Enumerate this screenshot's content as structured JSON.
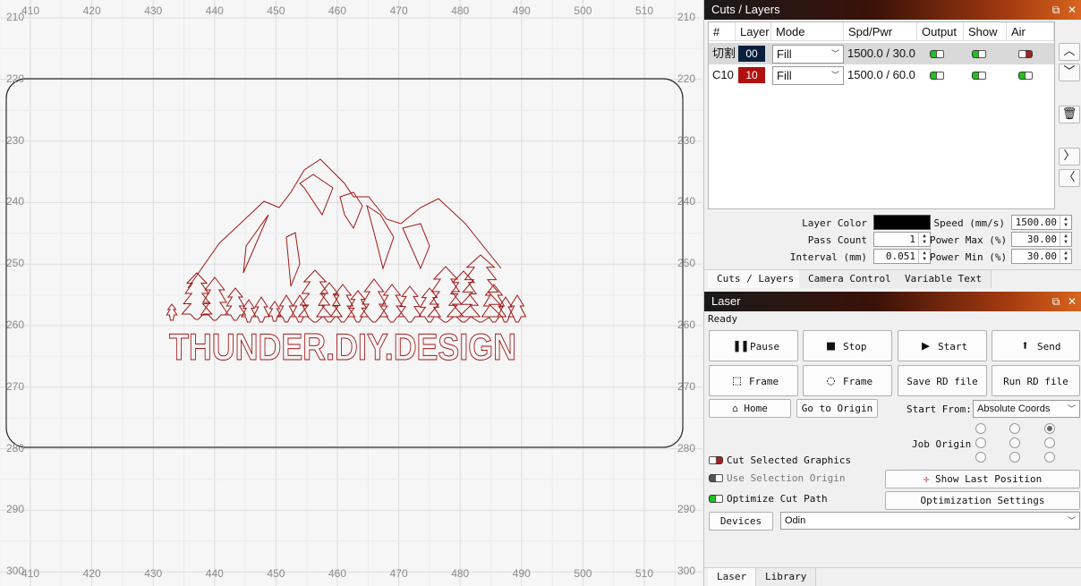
{
  "canvas": {
    "x_ticks": [
      "410",
      "420",
      "430",
      "440",
      "450",
      "460",
      "470",
      "480",
      "490",
      "500",
      "510"
    ],
    "y_ticks": [
      "210",
      "220",
      "230",
      "240",
      "250",
      "260",
      "270",
      "280",
      "290",
      "300"
    ],
    "design_text": "THUNDER.DIY.DESIGN",
    "design_color": "#a01818"
  },
  "cuts_panel": {
    "title": "Cuts / Layers",
    "columns": [
      "#",
      "Layer",
      "Mode",
      "Spd/Pwr",
      "Output",
      "Show",
      "Air"
    ],
    "rows": [
      {
        "num": "切割",
        "layer": "00",
        "layer_color": "#0a1f3d",
        "mode": "Fill",
        "spdpwr": "1500.0 / 30.0",
        "output": true,
        "show": true,
        "air": false
      },
      {
        "num": "C10",
        "layer": "10",
        "layer_color": "#b01010",
        "mode": "Fill",
        "spdpwr": "1500.0 / 60.0",
        "output": true,
        "show": true,
        "air": true
      }
    ],
    "props": {
      "layer_color_label": "Layer Color",
      "layer_color_value": "#000000",
      "pass_count_label": "Pass Count",
      "pass_count_value": "1",
      "interval_label": "Interval (mm)",
      "interval_value": "0.051",
      "speed_label": "Speed (mm/s)",
      "speed_value": "1500.00",
      "power_max_label": "Power Max (%)",
      "power_max_value": "30.00",
      "power_min_label": "Power Min (%)",
      "power_min_value": "30.00"
    },
    "tabs": [
      "Cuts / Layers",
      "Camera Control",
      "Variable Text"
    ]
  },
  "laser_panel": {
    "title": "Laser",
    "status": "Ready",
    "buttons": {
      "pause": "Pause",
      "stop": "Stop",
      "start": "Start",
      "send": "Send",
      "frame1": "Frame",
      "frame2": "Frame",
      "save_rd": "Save RD file",
      "run_rd": "Run RD file",
      "home": "Home",
      "go_origin": "Go to Origin",
      "show_last": "Show Last Position",
      "opt_settings": "Optimization Settings",
      "devices": "Devices"
    },
    "start_from_label": "Start From:",
    "start_from_value": "Absolute Coords",
    "job_origin_label": "Job Origin",
    "cut_selected": "Cut Selected Graphics",
    "use_selection_origin": "Use Selection Origin",
    "optimize_cut_path": "Optimize Cut Path",
    "device_value": "Odin",
    "tabs": [
      "Laser",
      "Library"
    ]
  }
}
